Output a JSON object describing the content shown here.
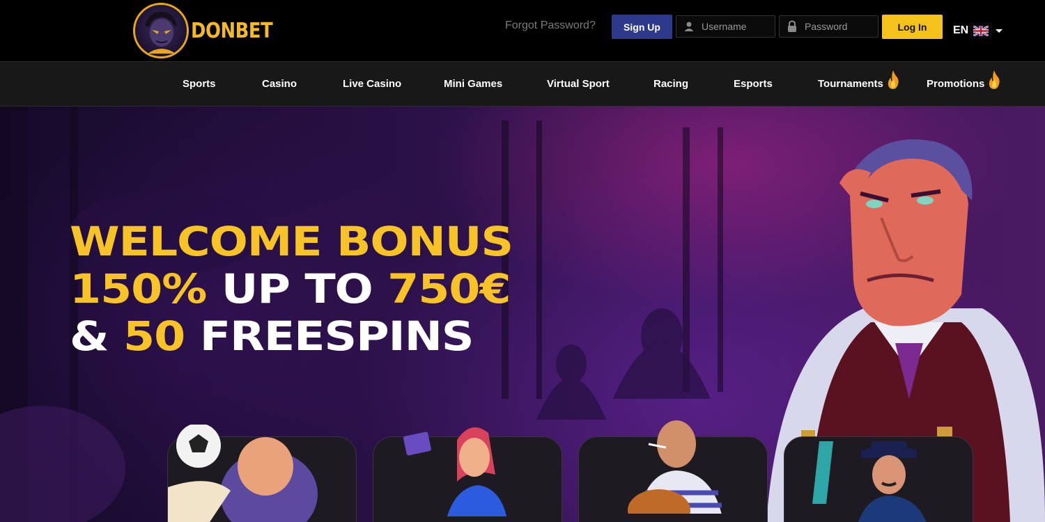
{
  "header": {
    "logo_text": "DONBET",
    "forgot_label": "Forgot Password?",
    "signup_label": "Sign Up",
    "username_placeholder": "Username",
    "password_placeholder": "Password",
    "login_label": "Log In",
    "language_code": "EN",
    "colors": {
      "signup": "#2d3a8c",
      "login": "#f5c21b",
      "logo": "#f5b82a"
    }
  },
  "nav": {
    "items": [
      {
        "label": "Sports"
      },
      {
        "label": "Casino"
      },
      {
        "label": "Live Casino"
      },
      {
        "label": "Mini Games"
      },
      {
        "label": "Virtual Sport"
      },
      {
        "label": "Racing"
      },
      {
        "label": "Esports"
      },
      {
        "label": "Tournaments",
        "icon": "flame-icon"
      },
      {
        "label": "Promotions",
        "icon": "flame-icon"
      }
    ]
  },
  "hero": {
    "line1": {
      "a": "WELCOME BONUS"
    },
    "line2": {
      "a": "150%",
      "b": " UP TO ",
      "c": "750€"
    },
    "line3": {
      "a": "& ",
      "b": "50",
      "c": " FREESPINS"
    },
    "accent_color": "#f7c326"
  },
  "tiles": [
    {
      "icon": "football-character-icon"
    },
    {
      "icon": "card-lady-icon"
    },
    {
      "icon": "chef-character-icon"
    },
    {
      "icon": "gangster-character-icon"
    }
  ]
}
